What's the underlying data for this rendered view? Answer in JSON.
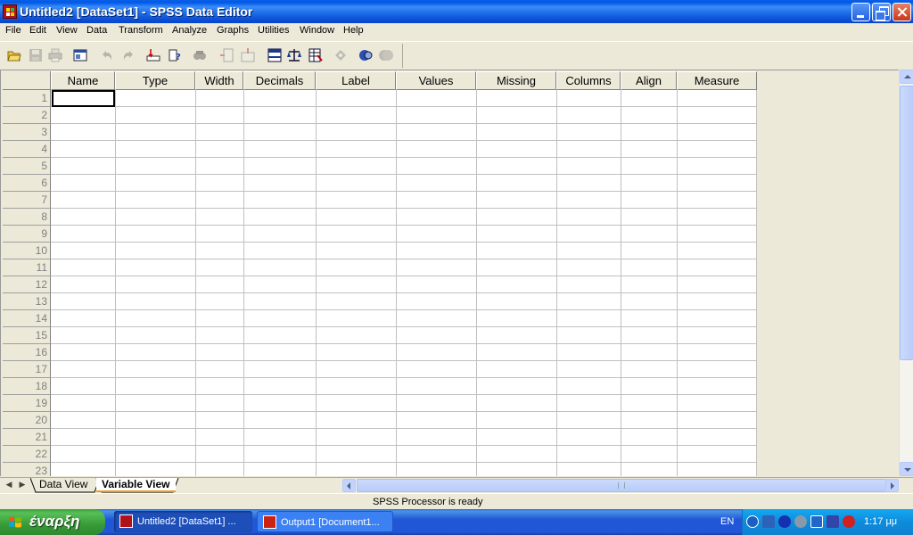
{
  "window": {
    "title": "Untitled2 [DataSet1] - SPSS Data Editor"
  },
  "menu": [
    "File",
    "Edit",
    "View",
    "Data",
    "Transform",
    "Analyze",
    "Graphs",
    "Utilities",
    "Window",
    "Help"
  ],
  "toolbar": {
    "icons": [
      "open-icon",
      "save-icon",
      "print-icon",
      "dialog-recall-icon",
      "undo-icon",
      "redo-icon",
      "goto-case-icon",
      "variables-icon",
      "find-icon",
      "insert-cases-icon",
      "insert-variable-icon",
      "split-file-icon",
      "weight-cases-icon",
      "select-cases-icon",
      "value-labels-icon",
      "use-sets-icon",
      "show-all-icon"
    ]
  },
  "grid": {
    "columns": [
      "Name",
      "Type",
      "Width",
      "Decimals",
      "Label",
      "Values",
      "Missing",
      "Columns",
      "Align",
      "Measure"
    ],
    "rows": [
      "1",
      "2",
      "3",
      "4",
      "5",
      "6",
      "7",
      "8",
      "9",
      "10",
      "11",
      "12",
      "13",
      "14",
      "15",
      "16",
      "17",
      "18",
      "19",
      "20",
      "21",
      "22",
      "23"
    ]
  },
  "tabs": {
    "data_view": "Data View",
    "variable_view": "Variable View",
    "active": "variable_view"
  },
  "status": {
    "text": "SPSS Processor is ready"
  },
  "taskbar": {
    "start": "έναρξη",
    "tasks": [
      "Untitled2 [DataSet1] ...",
      "Output1 [Document1..."
    ],
    "lang": "EN",
    "clock": "1:17 μμ"
  },
  "colors": {
    "titlebar": "#0A5FE8",
    "taskbar": "#2157D7",
    "start": "#379B37",
    "tray": "#0E8CDB"
  }
}
